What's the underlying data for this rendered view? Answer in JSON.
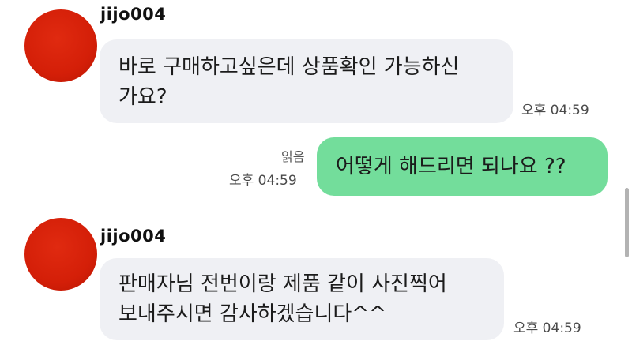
{
  "messages": [
    {
      "sender": "jijo004",
      "text": "바로 구매하고싶은데 상품확인 가능하신\n가요?",
      "time": "오후 04:59"
    },
    {
      "read_label": "읽음",
      "text": "어떻게 해드리면 되나요 ??",
      "time": "오후 04:59"
    },
    {
      "sender": "jijo004",
      "text": "판매자님 전번이랑 제품 같이 사진찍어\n보내주시면 감사하겠습니다^^",
      "time": "오후 04:59"
    }
  ],
  "colors": {
    "avatar": "#d41f08",
    "incoming_bubble": "#eff0f4",
    "outgoing_bubble": "#73dd9b"
  },
  "icons": [
    "avatar"
  ]
}
